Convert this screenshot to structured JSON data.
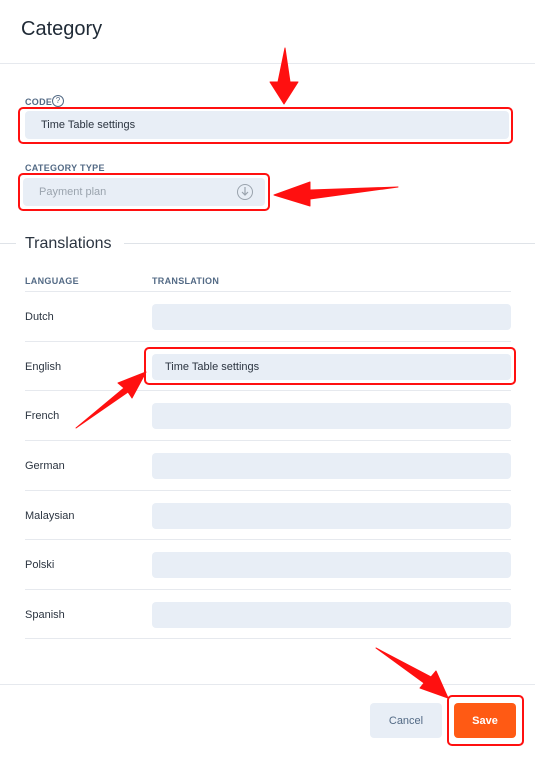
{
  "header": {
    "title": "Category"
  },
  "form": {
    "code_label": "CODE",
    "help_glyph": "?",
    "code_value": "Time Table settings",
    "category_type_label": "CATEGORY TYPE",
    "category_type_value": "Payment plan"
  },
  "translations": {
    "section_title": "Translations",
    "col_language": "LANGUAGE",
    "col_translation": "TRANSLATION",
    "rows": [
      {
        "language": "Dutch",
        "translation": ""
      },
      {
        "language": "English",
        "translation": "Time Table settings"
      },
      {
        "language": "French",
        "translation": ""
      },
      {
        "language": "German",
        "translation": ""
      },
      {
        "language": "Malaysian",
        "translation": ""
      },
      {
        "language": "Polski",
        "translation": ""
      },
      {
        "language": "Spanish",
        "translation": ""
      }
    ]
  },
  "footer": {
    "cancel_label": "Cancel",
    "save_label": "Save"
  },
  "colors": {
    "accent": "#ff5a14",
    "annotation": "#ff1010",
    "field_bg": "#e8eef6",
    "label": "#536a85"
  },
  "icons": {
    "help": "help-icon",
    "select": "chevron-down-circle-icon"
  }
}
